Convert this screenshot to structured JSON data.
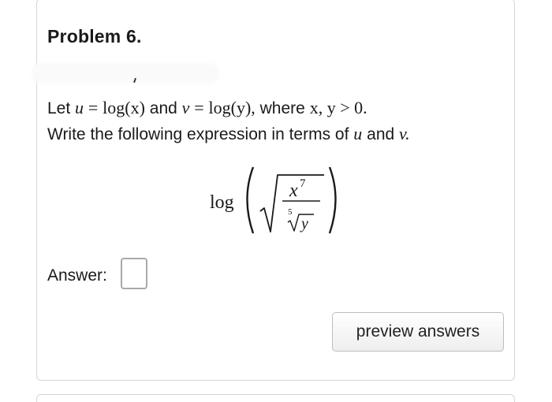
{
  "problem": {
    "title": "Problem 6."
  },
  "statement": {
    "line1": {
      "let": "Let",
      "u": "u",
      "eq1": "=",
      "log_x": "log(x)",
      "and": "and",
      "v": "v",
      "eq2": "=",
      "log_y": "log(y),",
      "where": "where",
      "condition": "x, y > 0."
    },
    "line2": {
      "text": "Write the following expression in terms of",
      "u": "u",
      "and": "and",
      "v": "v."
    }
  },
  "expression": {
    "log": "log",
    "numerator_base": "x",
    "numerator_exp": "7",
    "root_index": "5",
    "denominator": "y"
  },
  "answer": {
    "label": "Answer:",
    "value": ""
  },
  "buttons": {
    "preview": "preview answers"
  }
}
